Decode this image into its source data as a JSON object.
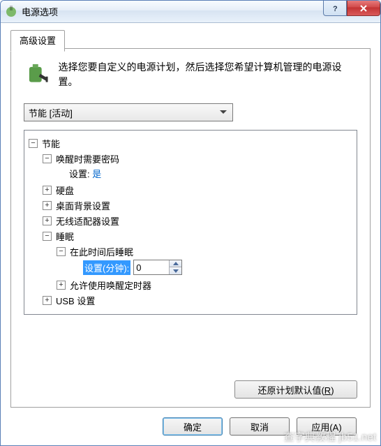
{
  "window": {
    "title": "电源选项"
  },
  "titlebar_buttons": {
    "help_name": "help-icon",
    "close_name": "close-icon"
  },
  "tab": {
    "label": "高级设置"
  },
  "intro": {
    "text": "选择您要自定义的电源计划，然后选择您希望计算机管理的电源设置。"
  },
  "plan_combo": {
    "selected": "节能 [活动]"
  },
  "tree": {
    "root": {
      "label": "节能",
      "children": {
        "wake_password": {
          "label": "唤醒时需要密码",
          "setting_label": "设置:",
          "setting_value": "是"
        },
        "hdd": {
          "label": "硬盘"
        },
        "desktop_bg": {
          "label": "桌面背景设置"
        },
        "wireless": {
          "label": "无线适配器设置"
        },
        "sleep": {
          "label": "睡眠",
          "children": {
            "sleep_after": {
              "label": "在此时间后睡眠",
              "setting_edit_label": "设置(分钟):",
              "setting_edit_value": "0"
            },
            "wake_timer": {
              "label": "允许使用唤醒定时器"
            }
          }
        },
        "usb": {
          "label": "USB 设置"
        }
      }
    }
  },
  "restore_button": {
    "label_pre": "还原计划默认值(",
    "accel": "R",
    "label_post": ")"
  },
  "dialog_buttons": {
    "ok": "确定",
    "cancel": "取消",
    "apply": "应用(A)"
  },
  "watermark": "查字典教程 jb51.net"
}
